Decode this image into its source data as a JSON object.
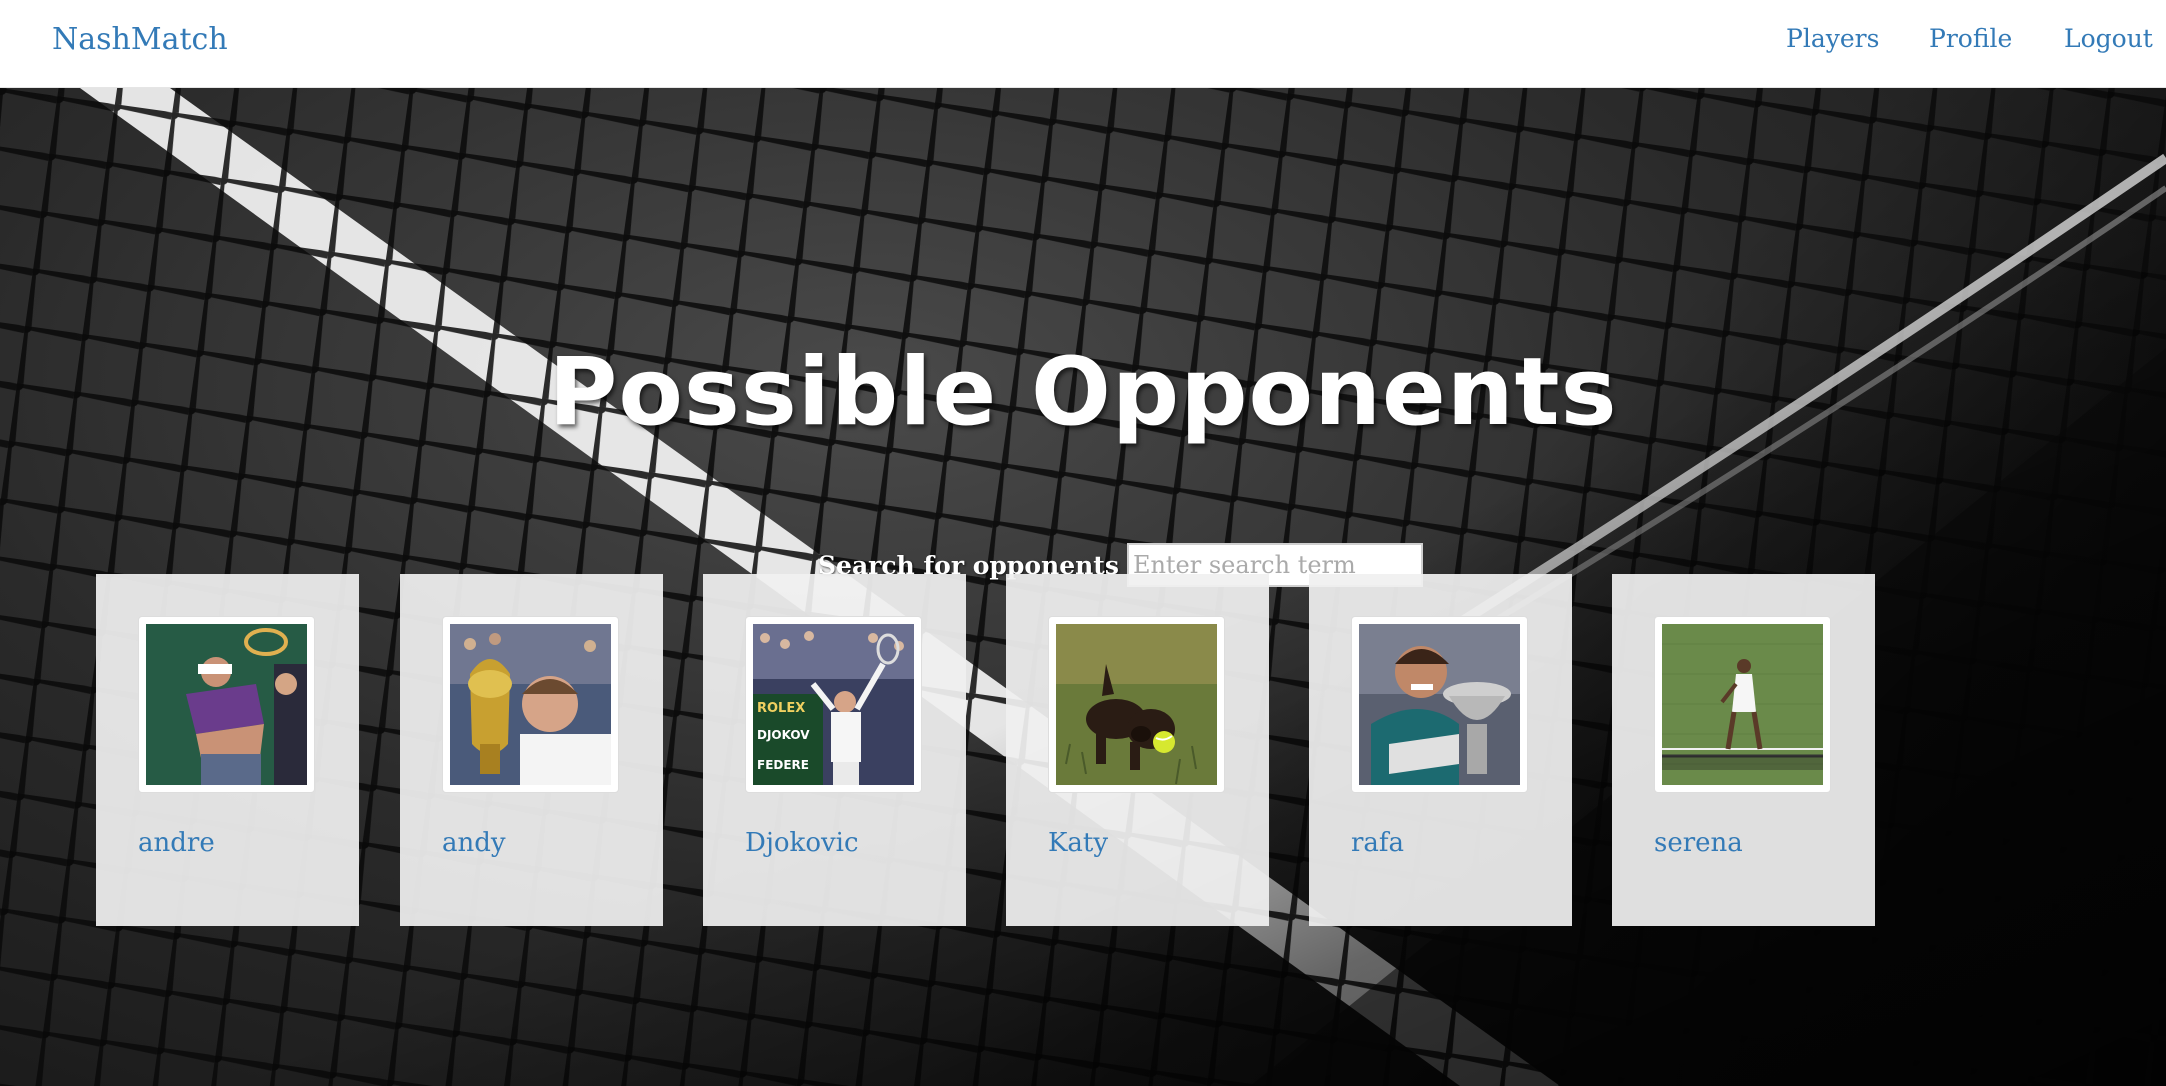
{
  "nav": {
    "brand": "NashMatch",
    "links": [
      {
        "label": "Players"
      },
      {
        "label": "Profile"
      },
      {
        "label": "Logout"
      }
    ]
  },
  "hero": {
    "title": "Possible Opponents"
  },
  "search": {
    "label": "Search for opponents",
    "placeholder": "Enter search term",
    "value": ""
  },
  "players": [
    {
      "name": "andre",
      "photo": "tennis-player-forehand"
    },
    {
      "name": "andy",
      "photo": "player-kissing-trophy"
    },
    {
      "name": "Djokovic",
      "photo": "player-celebrating"
    },
    {
      "name": "Katy",
      "photo": "dog-with-tennis-ball"
    },
    {
      "name": "rafa",
      "photo": "player-biting-trophy"
    },
    {
      "name": "serena",
      "photo": "player-on-grass-court"
    }
  ],
  "colors": {
    "link": "#337ab7",
    "card_bg": "#f0f0f0",
    "navbar_bg": "#ffffff"
  }
}
